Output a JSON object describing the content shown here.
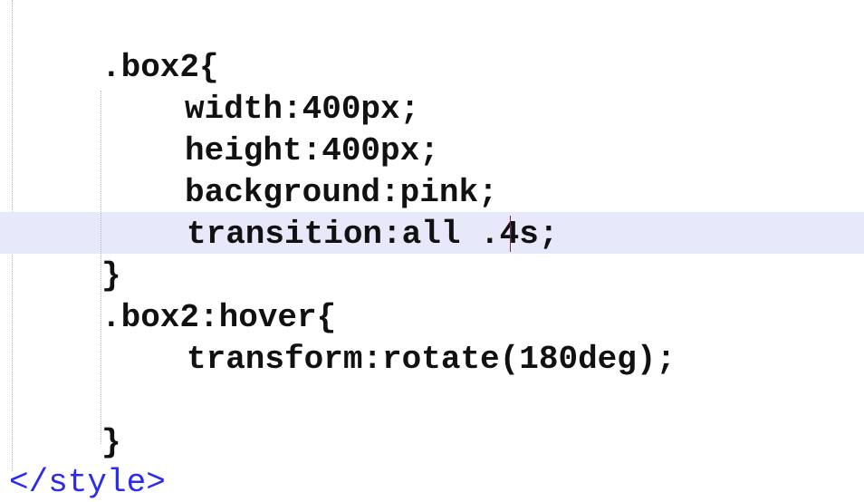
{
  "editor": {
    "lines": [
      ".box2{",
      "width:400px;",
      "height:400px;",
      "background:pink;",
      "transition:all .4s;",
      "}",
      ".box2:hover{",
      "transform:rotate(180deg);",
      "",
      "}"
    ],
    "closing_tag": "</style>"
  },
  "colors": {
    "code_text": "#111111",
    "tag_text": "#2a2af0",
    "current_line_highlight": "#e8e8fb",
    "caret": "#7a2a5a"
  }
}
